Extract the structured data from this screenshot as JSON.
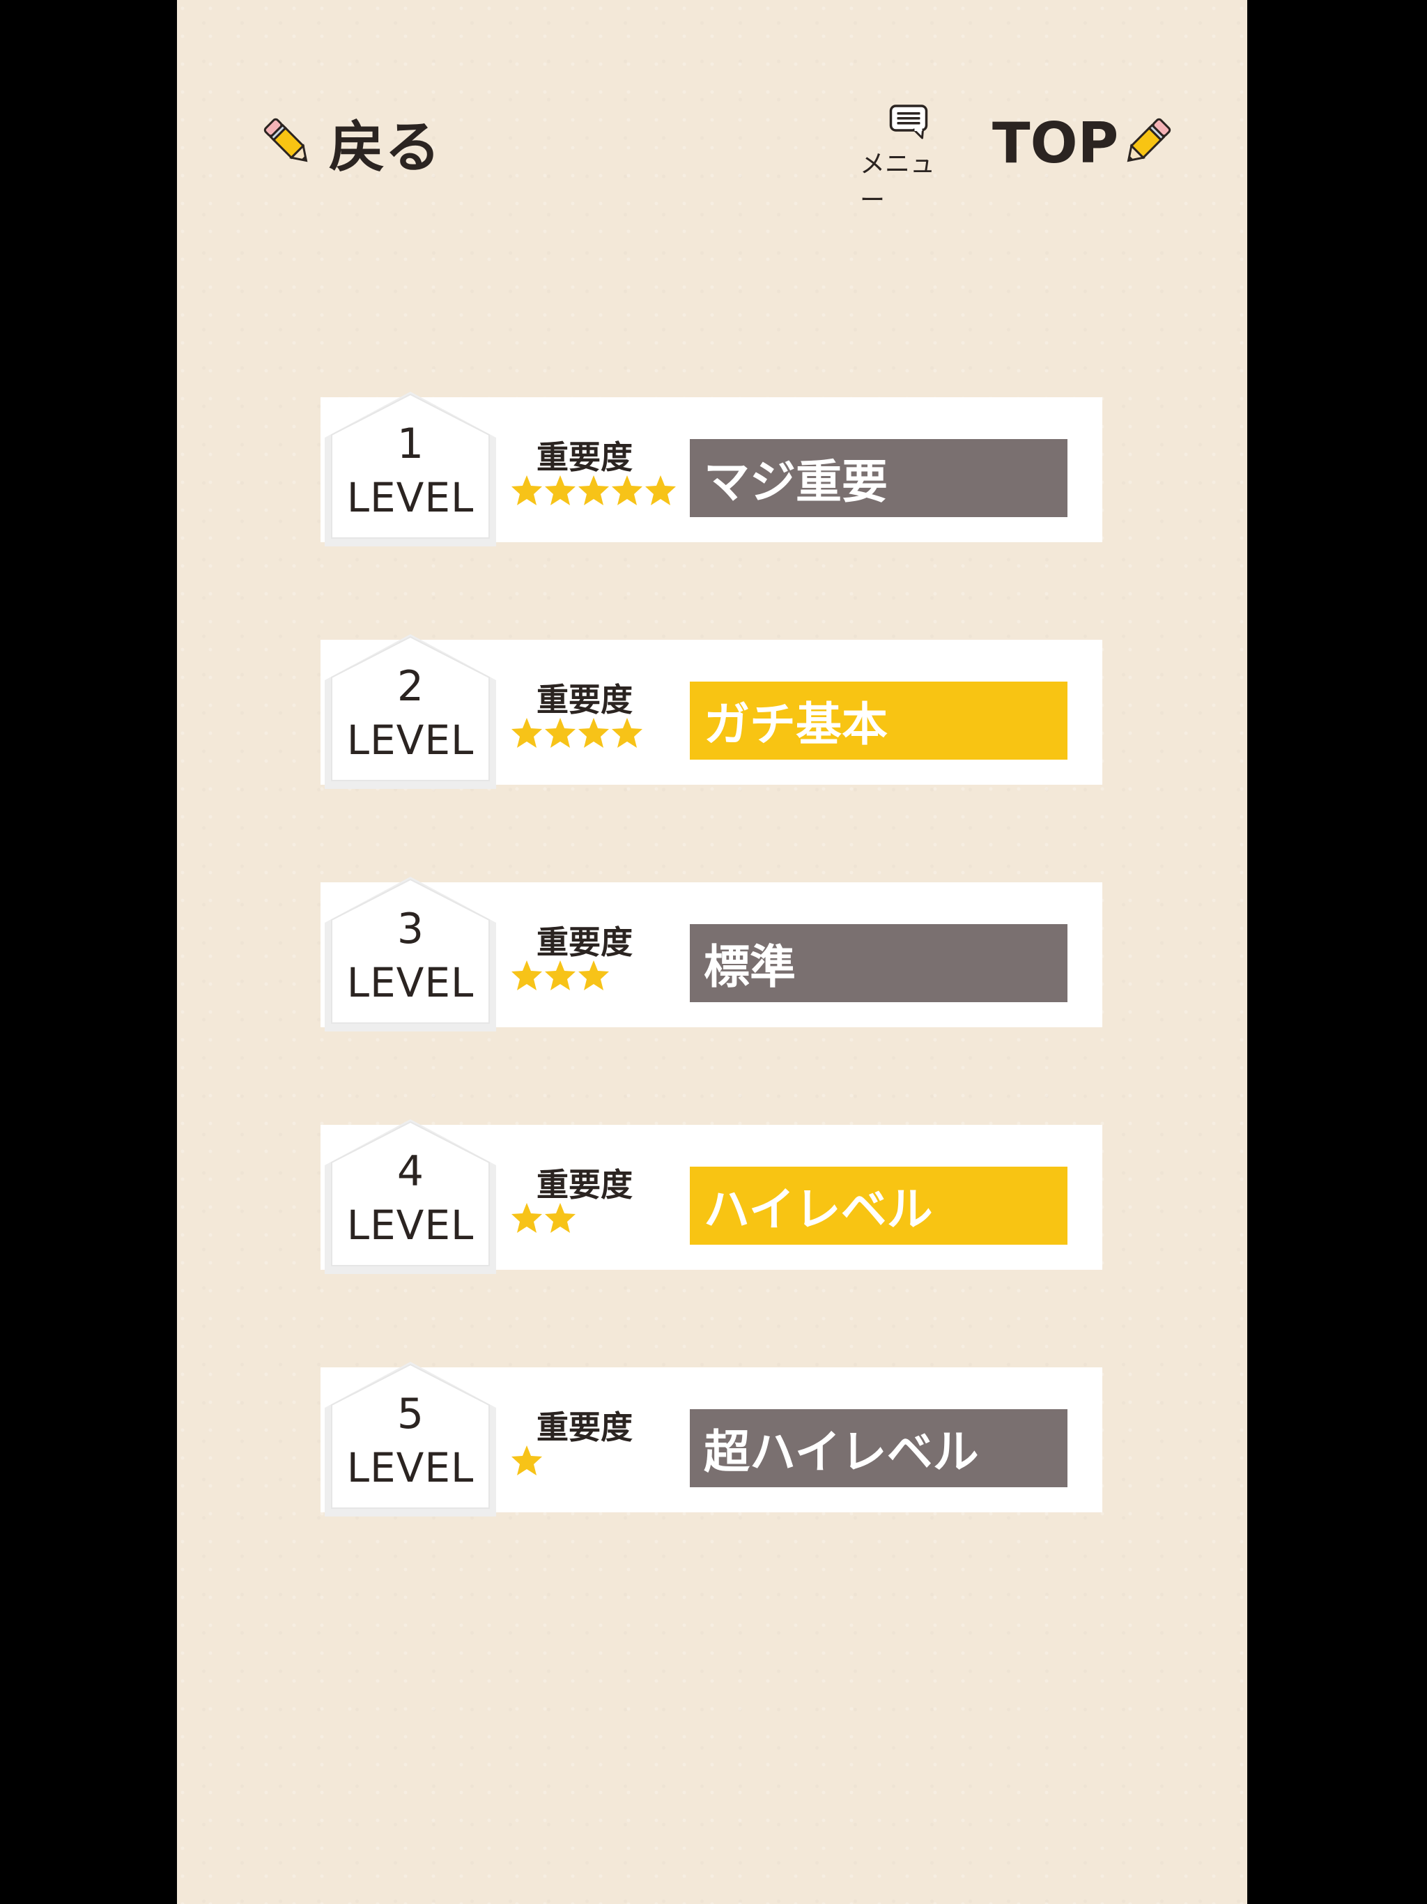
{
  "nav": {
    "back_label": "戻る",
    "menu_label": "メニュー",
    "top_label": "TOP"
  },
  "colors": {
    "background": "#f3e8d8",
    "card": "#ffffff",
    "star": "#f7c318",
    "badge_gray": "#7a7070",
    "badge_yellow": "#f8c413"
  },
  "importance_label": "重要度",
  "levels": [
    {
      "number": "1",
      "level_label": "LEVEL",
      "stars": 5,
      "badge_text": "マジ重要",
      "badge_color": "gray"
    },
    {
      "number": "2",
      "level_label": "LEVEL",
      "stars": 4,
      "badge_text": "ガチ基本",
      "badge_color": "yellow"
    },
    {
      "number": "3",
      "level_label": "LEVEL",
      "stars": 3,
      "badge_text": "標準",
      "badge_color": "gray"
    },
    {
      "number": "4",
      "level_label": "LEVEL",
      "stars": 2,
      "badge_text": "ハイレベル",
      "badge_color": "yellow"
    },
    {
      "number": "5",
      "level_label": "LEVEL",
      "stars": 1,
      "badge_text": "超ハイレベル",
      "badge_color": "gray"
    }
  ]
}
